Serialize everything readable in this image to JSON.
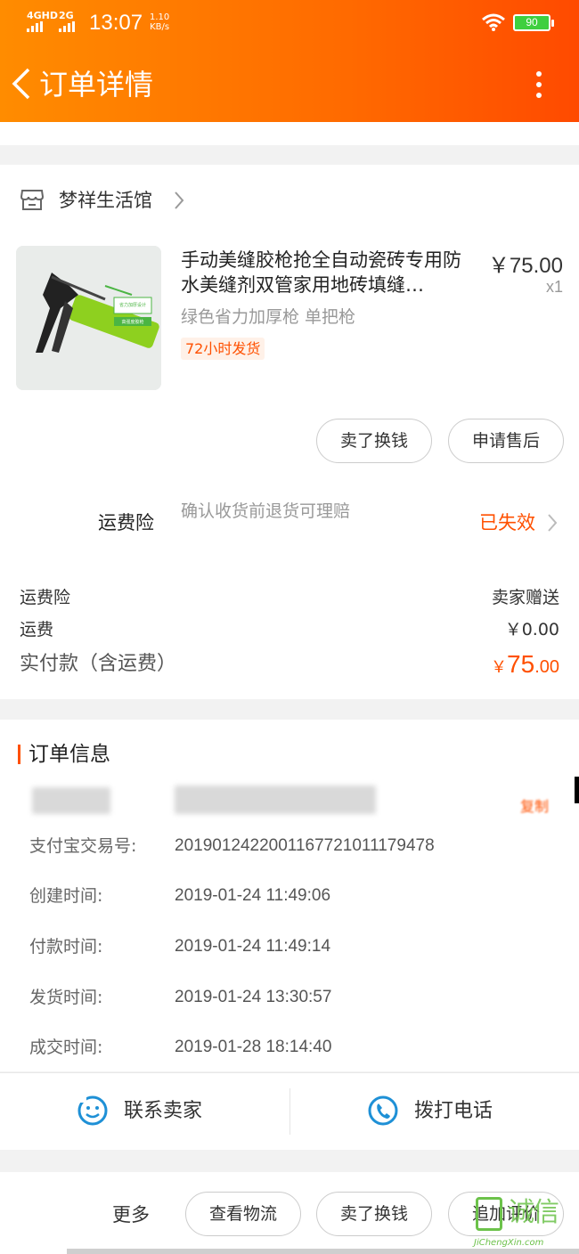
{
  "status_bar": {
    "network_1": "4GHD",
    "network_2": "2G",
    "time": "13:07",
    "speed_value": "1.10",
    "speed_unit": "KB/s",
    "battery": "90"
  },
  "nav": {
    "title": "订单详情",
    "back_icon": "chevron-left-icon",
    "more_icon": "more-vertical-icon"
  },
  "shop": {
    "name": "梦祥生活馆",
    "icon": "store-icon"
  },
  "product": {
    "title": "手动美缝胶枪抢全自动瓷砖专用防水美缝剂双管家用地砖填缝…",
    "price": "￥75.00",
    "quantity": "x1",
    "sku": "绿色省力加厚枪  单把枪",
    "shipping_badge": "72小时发货",
    "image_label_1": "省力加厚设计",
    "image_label_2": "高强度胶枪"
  },
  "actions": {
    "sell_button": "卖了换钱",
    "after_sale_button": "申请售后"
  },
  "insurance": {
    "label": "运费险",
    "description": "确认收货前退货可理赔",
    "status": "已失效"
  },
  "fees": {
    "insurance_label": "运费险",
    "insurance_value": "卖家赠送",
    "shipping_label": "运费",
    "shipping_value": "￥0.00",
    "total_label": "实付款（含运费）",
    "total_currency": "￥",
    "total_int": "75",
    "total_dec": ".00"
  },
  "order_info": {
    "title": "订单信息",
    "copy": "复制",
    "rows": [
      {
        "label": "支付宝交易号:",
        "value": "2019012422001167721011179478"
      },
      {
        "label": "创建时间:",
        "value": "2019-01-24 11:49:06"
      },
      {
        "label": "付款时间:",
        "value": "2019-01-24 11:49:14"
      },
      {
        "label": "发货时间:",
        "value": "2019-01-24 13:30:57"
      },
      {
        "label": "成交时间:",
        "value": "2019-01-28 18:14:40"
      }
    ]
  },
  "contact": {
    "seller_label": "联系卖家",
    "phone_label": "拨打电话"
  },
  "bottom_bar": {
    "more_label": "更多",
    "logistics_button": "查看物流",
    "sell_button": "卖了换钱",
    "review_button": "追加评价"
  },
  "watermark": {
    "cn": "诚信",
    "en": "JiChengXin.com"
  },
  "colors": {
    "accent": "#ff5000",
    "header_start": "#ff8c00",
    "header_end": "#ff4a00",
    "icon_blue": "#1e90d6"
  }
}
